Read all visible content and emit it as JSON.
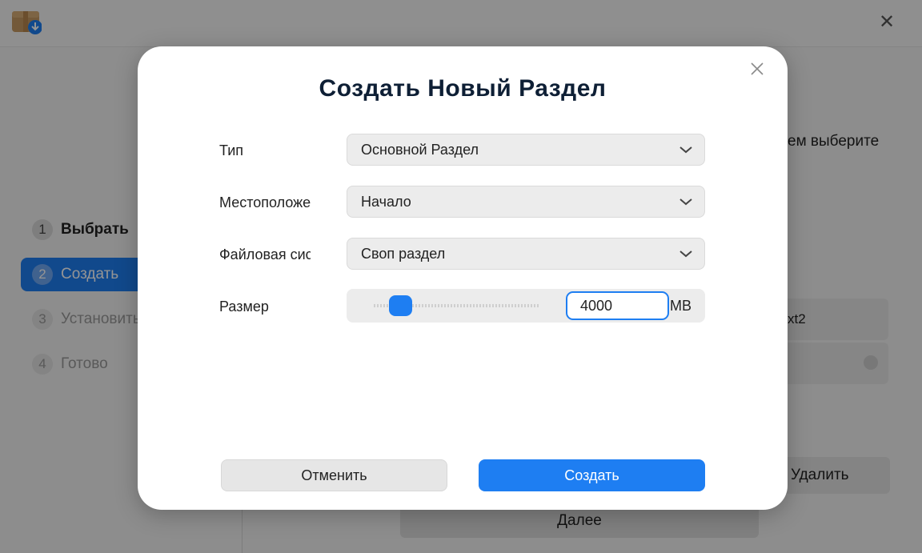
{
  "background": {
    "steps": [
      {
        "num": "1",
        "label": "Выбрать",
        "state": "done"
      },
      {
        "num": "2",
        "label": "Создать",
        "state": "active"
      },
      {
        "num": "3",
        "label": "Установить",
        "state": "todo"
      },
      {
        "num": "4",
        "label": "Готово",
        "state": "todo"
      }
    ],
    "hint_text": "ем выберите",
    "row_text": "xt2",
    "delete_label": "Удалить",
    "next_label": "Далее"
  },
  "dialog": {
    "title": "Создать Новый Раздел",
    "type_label": "Тип",
    "type_value": "Основной Раздел",
    "location_label": "Местоположение",
    "location_value": "Начало",
    "filesystem_label": "Файловая система",
    "filesystem_value": "Своп раздел",
    "size_label": "Размер",
    "size_value": "4000",
    "size_unit": "MB",
    "cancel_label": "Отменить",
    "create_label": "Создать"
  },
  "colors": {
    "accent": "#1e7ef2",
    "title": "#0e1f35"
  },
  "icons": {
    "app": "installer-package-icon",
    "close": "close-icon",
    "dropdown": "chevron-down-icon"
  }
}
